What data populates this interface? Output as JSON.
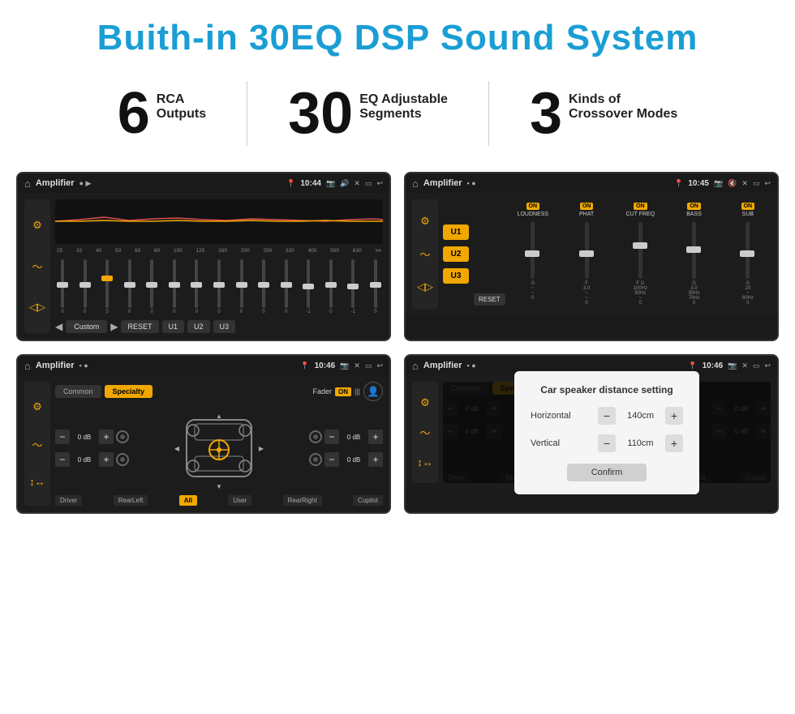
{
  "header": {
    "title": "Buith-in 30EQ DSP Sound System"
  },
  "stats": [
    {
      "number": "6",
      "line1": "RCA",
      "line2": "Outputs"
    },
    {
      "number": "30",
      "line1": "EQ Adjustable",
      "line2": "Segments"
    },
    {
      "number": "3",
      "line1": "Kinds of",
      "line2": "Crossover Modes"
    }
  ],
  "screens": {
    "top_left": {
      "app": "Amplifier",
      "time": "10:44",
      "eq_freqs": [
        "25",
        "32",
        "40",
        "50",
        "63",
        "80",
        "100",
        "125",
        "160",
        "200",
        "250",
        "320",
        "400",
        "500",
        "630"
      ],
      "eq_vals": [
        "0",
        "0",
        "0",
        "5",
        "0",
        "0",
        "0",
        "0",
        "0",
        "0",
        "0",
        "0",
        "0",
        "-1",
        "0",
        "-1"
      ],
      "preset": "Custom",
      "btns": [
        "RESET",
        "U1",
        "U2",
        "U3"
      ]
    },
    "top_right": {
      "app": "Amplifier",
      "time": "10:45",
      "presets": [
        "U1",
        "U2",
        "U3"
      ],
      "channels": [
        "LOUDNESS",
        "PHAT",
        "CUT FREQ",
        "BASS",
        "SUB"
      ],
      "all_on": true
    },
    "bottom_left": {
      "app": "Amplifier",
      "time": "10:46",
      "tabs": [
        "Common",
        "Specialty"
      ],
      "active_tab": "Specialty",
      "fader_label": "Fader",
      "fader_on": true,
      "db_values": [
        "0 dB",
        "0 dB",
        "0 dB",
        "0 dB"
      ],
      "bottom_labels": [
        "Driver",
        "RearLeft",
        "All",
        "User",
        "RearRight",
        "Copilot"
      ]
    },
    "bottom_right": {
      "app": "Amplifier",
      "time": "10:46",
      "tabs": [
        "Common",
        "Specialty"
      ],
      "modal_title": "Car speaker distance setting",
      "horizontal_label": "Horizontal",
      "horizontal_val": "140cm",
      "vertical_label": "Vertical",
      "vertical_val": "110cm",
      "confirm_label": "Confirm",
      "bottom_labels": [
        "Driver",
        "RearLef...",
        "All",
        "User",
        "RearRight",
        "Copilot"
      ]
    }
  }
}
